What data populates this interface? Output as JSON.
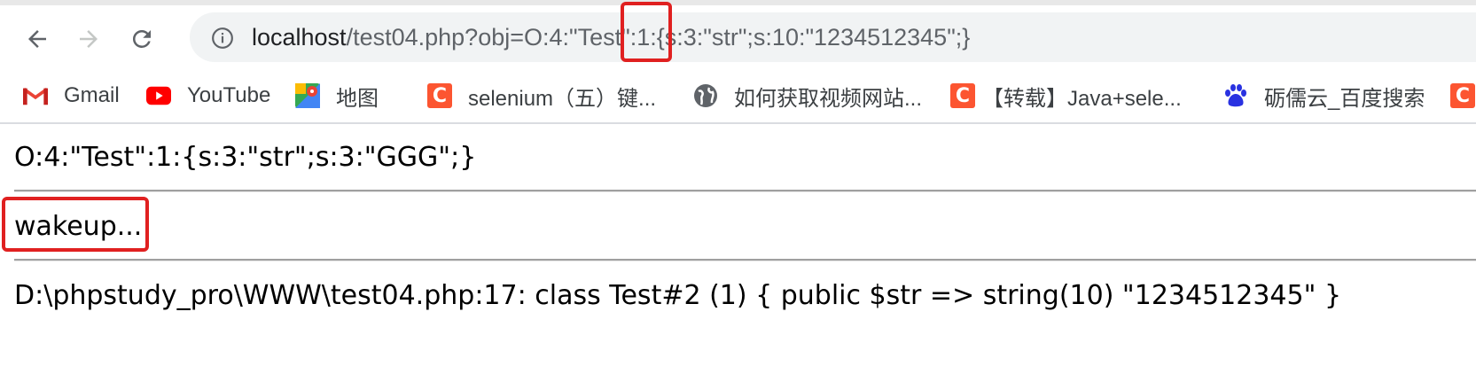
{
  "browser": {
    "url_host": "localhost",
    "url_rest": "/test04.php?obj=O:4:\"Test\":1:{s:3:\"str\";s:10:\"1234512345\";}"
  },
  "bookmarks": [
    {
      "label": "Gmail",
      "icon": "gmail-icon"
    },
    {
      "label": "YouTube",
      "icon": "youtube-icon"
    },
    {
      "label": "地图",
      "icon": "maps-icon"
    },
    {
      "label": "selenium（五）键...",
      "icon": "csdn-icon"
    },
    {
      "label": "如何获取视频网站...",
      "icon": "globe-icon"
    },
    {
      "label": "【转载】Java+sele...",
      "icon": "csdn-icon"
    },
    {
      "label": "砺儒云_百度搜索",
      "icon": "baidu-icon"
    }
  ],
  "page": {
    "line1": "O:4:\"Test\":1:{s:3:\"str\";s:3:\"GGG\";}",
    "line2": "wakeup...",
    "line3": "D:\\phpstudy_pro\\WWW\\test04.php:17: class Test#2 (1) { public $str => string(10) \"1234512345\" }"
  },
  "colors": {
    "annotation_red": "#e02020",
    "csdn_orange": "#fc5531",
    "omnibox_bg": "#f1f3f4"
  }
}
